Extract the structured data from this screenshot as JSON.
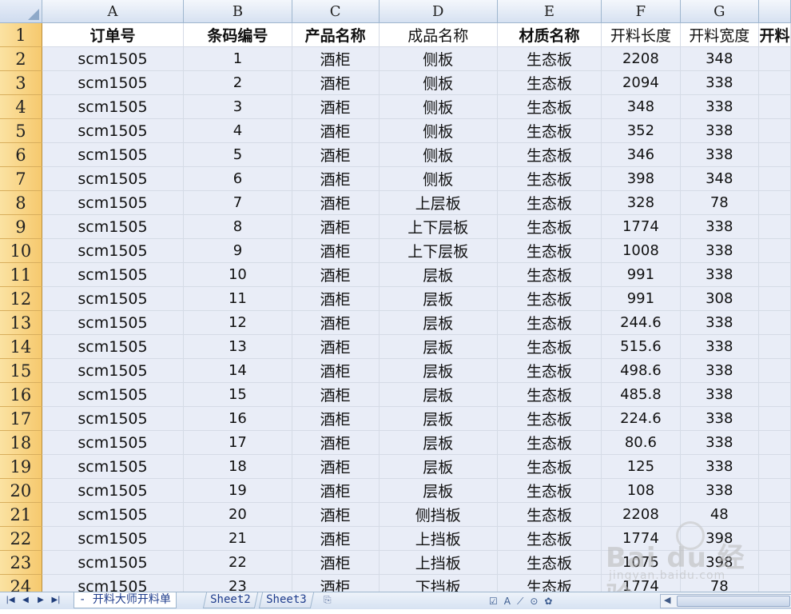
{
  "columns": [
    "A",
    "B",
    "C",
    "D",
    "E",
    "F",
    "G",
    ""
  ],
  "header_row": {
    "row_number": "1",
    "cells": [
      "订单号",
      "条码编号",
      "产品名称",
      "成品名称",
      "材质名称",
      "开料长度",
      "开料宽度",
      "开料"
    ]
  },
  "rows": [
    {
      "n": "2",
      "order": "scm1505",
      "barcode": "1",
      "product": "酒柜",
      "part": "侧板",
      "material": "生态板",
      "length": "2208",
      "width": "348"
    },
    {
      "n": "3",
      "order": "scm1505",
      "barcode": "2",
      "product": "酒柜",
      "part": "侧板",
      "material": "生态板",
      "length": "2094",
      "width": "338"
    },
    {
      "n": "4",
      "order": "scm1505",
      "barcode": "3",
      "product": "酒柜",
      "part": "侧板",
      "material": "生态板",
      "length": "348",
      "width": "338"
    },
    {
      "n": "5",
      "order": "scm1505",
      "barcode": "4",
      "product": "酒柜",
      "part": "侧板",
      "material": "生态板",
      "length": "352",
      "width": "338"
    },
    {
      "n": "6",
      "order": "scm1505",
      "barcode": "5",
      "product": "酒柜",
      "part": "侧板",
      "material": "生态板",
      "length": "346",
      "width": "338"
    },
    {
      "n": "7",
      "order": "scm1505",
      "barcode": "6",
      "product": "酒柜",
      "part": "侧板",
      "material": "生态板",
      "length": "398",
      "width": "348"
    },
    {
      "n": "8",
      "order": "scm1505",
      "barcode": "7",
      "product": "酒柜",
      "part": "上层板",
      "material": "生态板",
      "length": "328",
      "width": "78"
    },
    {
      "n": "9",
      "order": "scm1505",
      "barcode": "8",
      "product": "酒柜",
      "part": "上下层板",
      "material": "生态板",
      "length": "1774",
      "width": "338"
    },
    {
      "n": "10",
      "order": "scm1505",
      "barcode": "9",
      "product": "酒柜",
      "part": "上下层板",
      "material": "生态板",
      "length": "1008",
      "width": "338"
    },
    {
      "n": "11",
      "order": "scm1505",
      "barcode": "10",
      "product": "酒柜",
      "part": "层板",
      "material": "生态板",
      "length": "991",
      "width": "338"
    },
    {
      "n": "12",
      "order": "scm1505",
      "barcode": "11",
      "product": "酒柜",
      "part": "层板",
      "material": "生态板",
      "length": "991",
      "width": "308"
    },
    {
      "n": "13",
      "order": "scm1505",
      "barcode": "12",
      "product": "酒柜",
      "part": "层板",
      "material": "生态板",
      "length": "244.6",
      "width": "338"
    },
    {
      "n": "14",
      "order": "scm1505",
      "barcode": "13",
      "product": "酒柜",
      "part": "层板",
      "material": "生态板",
      "length": "515.6",
      "width": "338"
    },
    {
      "n": "15",
      "order": "scm1505",
      "barcode": "14",
      "product": "酒柜",
      "part": "层板",
      "material": "生态板",
      "length": "498.6",
      "width": "338"
    },
    {
      "n": "16",
      "order": "scm1505",
      "barcode": "15",
      "product": "酒柜",
      "part": "层板",
      "material": "生态板",
      "length": "485.8",
      "width": "338"
    },
    {
      "n": "17",
      "order": "scm1505",
      "barcode": "16",
      "product": "酒柜",
      "part": "层板",
      "material": "生态板",
      "length": "224.6",
      "width": "338"
    },
    {
      "n": "18",
      "order": "scm1505",
      "barcode": "17",
      "product": "酒柜",
      "part": "层板",
      "material": "生态板",
      "length": "80.6",
      "width": "338"
    },
    {
      "n": "19",
      "order": "scm1505",
      "barcode": "18",
      "product": "酒柜",
      "part": "层板",
      "material": "生态板",
      "length": "125",
      "width": "338"
    },
    {
      "n": "20",
      "order": "scm1505",
      "barcode": "19",
      "product": "酒柜",
      "part": "层板",
      "material": "生态板",
      "length": "108",
      "width": "338"
    },
    {
      "n": "21",
      "order": "scm1505",
      "barcode": "20",
      "product": "酒柜",
      "part": "侧挡板",
      "material": "生态板",
      "length": "2208",
      "width": "48"
    },
    {
      "n": "22",
      "order": "scm1505",
      "barcode": "21",
      "product": "酒柜",
      "part": "上挡板",
      "material": "生态板",
      "length": "1774",
      "width": "398"
    },
    {
      "n": "23",
      "order": "scm1505",
      "barcode": "22",
      "product": "酒柜",
      "part": "上挡板",
      "material": "生态板",
      "length": "1075",
      "width": "398"
    },
    {
      "n": "24",
      "order": "scm1505",
      "barcode": "23",
      "product": "酒柜",
      "part": "下挡板",
      "material": "生态板",
      "length": "1774",
      "width": "78"
    }
  ],
  "sheet_tabs": [
    {
      "label": "- 开料大师开料单",
      "active": true
    },
    {
      "label": "Sheet2",
      "active": false
    },
    {
      "label": "Sheet3",
      "active": false
    }
  ],
  "nav_buttons": [
    "first-sheet",
    "prev-sheet",
    "next-sheet",
    "last-sheet"
  ],
  "watermark": {
    "main": "Bai du 经验",
    "sub": "jingyan.baidu.com"
  },
  "colors": {
    "row_header": "#f6c96e",
    "column_header": "#d6e1f1",
    "cell_fill": "#e9edf7",
    "tab_text": "#1e3c8c"
  }
}
